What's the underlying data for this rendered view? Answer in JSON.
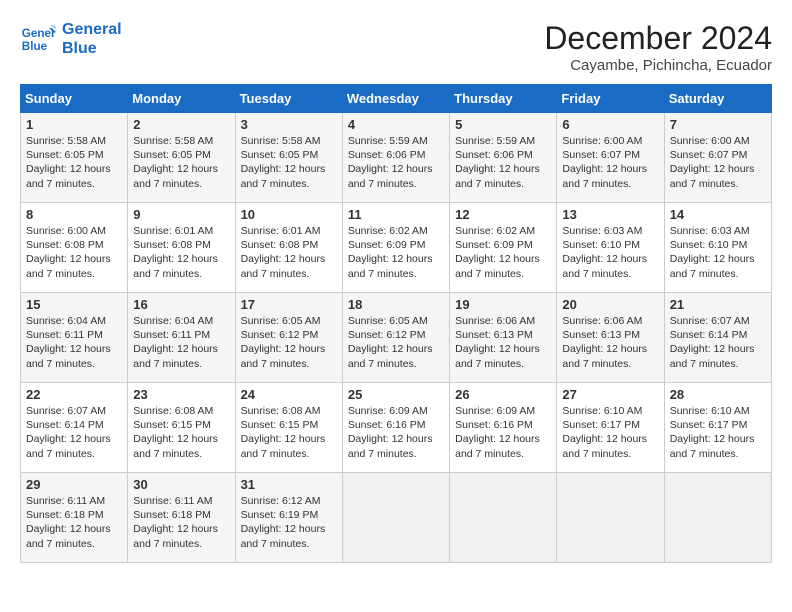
{
  "header": {
    "logo_line1": "General",
    "logo_line2": "Blue",
    "month": "December 2024",
    "location": "Cayambe, Pichincha, Ecuador"
  },
  "weekdays": [
    "Sunday",
    "Monday",
    "Tuesday",
    "Wednesday",
    "Thursday",
    "Friday",
    "Saturday"
  ],
  "weeks": [
    [
      {
        "day": "1",
        "sunrise": "5:58 AM",
        "sunset": "6:05 PM",
        "daylight": "12 hours and 7 minutes."
      },
      {
        "day": "2",
        "sunrise": "5:58 AM",
        "sunset": "6:05 PM",
        "daylight": "12 hours and 7 minutes."
      },
      {
        "day": "3",
        "sunrise": "5:58 AM",
        "sunset": "6:05 PM",
        "daylight": "12 hours and 7 minutes."
      },
      {
        "day": "4",
        "sunrise": "5:59 AM",
        "sunset": "6:06 PM",
        "daylight": "12 hours and 7 minutes."
      },
      {
        "day": "5",
        "sunrise": "5:59 AM",
        "sunset": "6:06 PM",
        "daylight": "12 hours and 7 minutes."
      },
      {
        "day": "6",
        "sunrise": "6:00 AM",
        "sunset": "6:07 PM",
        "daylight": "12 hours and 7 minutes."
      },
      {
        "day": "7",
        "sunrise": "6:00 AM",
        "sunset": "6:07 PM",
        "daylight": "12 hours and 7 minutes."
      }
    ],
    [
      {
        "day": "8",
        "sunrise": "6:00 AM",
        "sunset": "6:08 PM",
        "daylight": "12 hours and 7 minutes."
      },
      {
        "day": "9",
        "sunrise": "6:01 AM",
        "sunset": "6:08 PM",
        "daylight": "12 hours and 7 minutes."
      },
      {
        "day": "10",
        "sunrise": "6:01 AM",
        "sunset": "6:08 PM",
        "daylight": "12 hours and 7 minutes."
      },
      {
        "day": "11",
        "sunrise": "6:02 AM",
        "sunset": "6:09 PM",
        "daylight": "12 hours and 7 minutes."
      },
      {
        "day": "12",
        "sunrise": "6:02 AM",
        "sunset": "6:09 PM",
        "daylight": "12 hours and 7 minutes."
      },
      {
        "day": "13",
        "sunrise": "6:03 AM",
        "sunset": "6:10 PM",
        "daylight": "12 hours and 7 minutes."
      },
      {
        "day": "14",
        "sunrise": "6:03 AM",
        "sunset": "6:10 PM",
        "daylight": "12 hours and 7 minutes."
      }
    ],
    [
      {
        "day": "15",
        "sunrise": "6:04 AM",
        "sunset": "6:11 PM",
        "daylight": "12 hours and 7 minutes."
      },
      {
        "day": "16",
        "sunrise": "6:04 AM",
        "sunset": "6:11 PM",
        "daylight": "12 hours and 7 minutes."
      },
      {
        "day": "17",
        "sunrise": "6:05 AM",
        "sunset": "6:12 PM",
        "daylight": "12 hours and 7 minutes."
      },
      {
        "day": "18",
        "sunrise": "6:05 AM",
        "sunset": "6:12 PM",
        "daylight": "12 hours and 7 minutes."
      },
      {
        "day": "19",
        "sunrise": "6:06 AM",
        "sunset": "6:13 PM",
        "daylight": "12 hours and 7 minutes."
      },
      {
        "day": "20",
        "sunrise": "6:06 AM",
        "sunset": "6:13 PM",
        "daylight": "12 hours and 7 minutes."
      },
      {
        "day": "21",
        "sunrise": "6:07 AM",
        "sunset": "6:14 PM",
        "daylight": "12 hours and 7 minutes."
      }
    ],
    [
      {
        "day": "22",
        "sunrise": "6:07 AM",
        "sunset": "6:14 PM",
        "daylight": "12 hours and 7 minutes."
      },
      {
        "day": "23",
        "sunrise": "6:08 AM",
        "sunset": "6:15 PM",
        "daylight": "12 hours and 7 minutes."
      },
      {
        "day": "24",
        "sunrise": "6:08 AM",
        "sunset": "6:15 PM",
        "daylight": "12 hours and 7 minutes."
      },
      {
        "day": "25",
        "sunrise": "6:09 AM",
        "sunset": "6:16 PM",
        "daylight": "12 hours and 7 minutes."
      },
      {
        "day": "26",
        "sunrise": "6:09 AM",
        "sunset": "6:16 PM",
        "daylight": "12 hours and 7 minutes."
      },
      {
        "day": "27",
        "sunrise": "6:10 AM",
        "sunset": "6:17 PM",
        "daylight": "12 hours and 7 minutes."
      },
      {
        "day": "28",
        "sunrise": "6:10 AM",
        "sunset": "6:17 PM",
        "daylight": "12 hours and 7 minutes."
      }
    ],
    [
      {
        "day": "29",
        "sunrise": "6:11 AM",
        "sunset": "6:18 PM",
        "daylight": "12 hours and 7 minutes."
      },
      {
        "day": "30",
        "sunrise": "6:11 AM",
        "sunset": "6:18 PM",
        "daylight": "12 hours and 7 minutes."
      },
      {
        "day": "31",
        "sunrise": "6:12 AM",
        "sunset": "6:19 PM",
        "daylight": "12 hours and 7 minutes."
      },
      null,
      null,
      null,
      null
    ]
  ]
}
